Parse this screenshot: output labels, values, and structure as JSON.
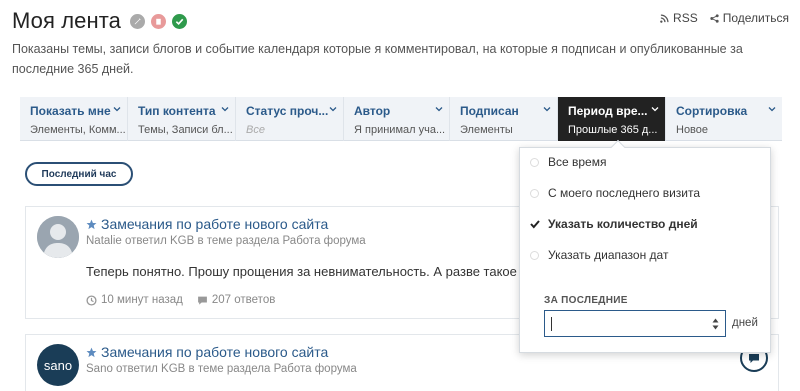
{
  "header": {
    "title": "Моя лента",
    "subtitle": "Показаны темы, записи блогов и событие календаря которые я комментировал, на которые я подписан и опубликованные за последние 365 дней.",
    "rss_label": "RSS",
    "share_label": "Поделиться"
  },
  "filters": [
    {
      "label": "Показать мне",
      "value": "Элементы, Комм..."
    },
    {
      "label": "Тип контента",
      "value": "Темы, Записи бл..."
    },
    {
      "label": "Статус проч...",
      "value": "Все"
    },
    {
      "label": "Автор",
      "value": "Я принимал уча..."
    },
    {
      "label": "Подписан",
      "value": "Элементы"
    },
    {
      "label": "Период вре...",
      "value": "Прошлые 365 д..."
    },
    {
      "label": "Сортировка",
      "value": "Новое"
    }
  ],
  "quick_filter": "Последний час",
  "feed": [
    {
      "title": "Замечания по работе нового сайта",
      "meta": "Natalie ответил KGB в теме раздела Работа форума",
      "snippet": "Теперь понятно. Прошу прощения за невнимательность. А разве такое",
      "time": "10 минут назад",
      "replies": "207 ответов"
    },
    {
      "title": "Замечания по работе нового сайта",
      "meta": "Sano ответил KGB в теме раздела Работа форума",
      "avatar_text": "sano"
    }
  ],
  "period_menu": {
    "options": [
      {
        "label": "Все время",
        "selected": false
      },
      {
        "label": "С моего последнего визита",
        "selected": false
      },
      {
        "label": "Указать количество дней",
        "selected": true
      },
      {
        "label": "Указать диапазон дат",
        "selected": false
      }
    ],
    "section_label": "ЗА ПОСЛЕДНИЕ",
    "days_value": "",
    "days_unit": "дней"
  },
  "colors": {
    "accent": "#2b5a8a",
    "active_filter_bg": "#222222",
    "filter_bar_bg": "#f0f3f7",
    "approve_green": "#2f9a4c",
    "delete_pink": "#e89a9a"
  }
}
